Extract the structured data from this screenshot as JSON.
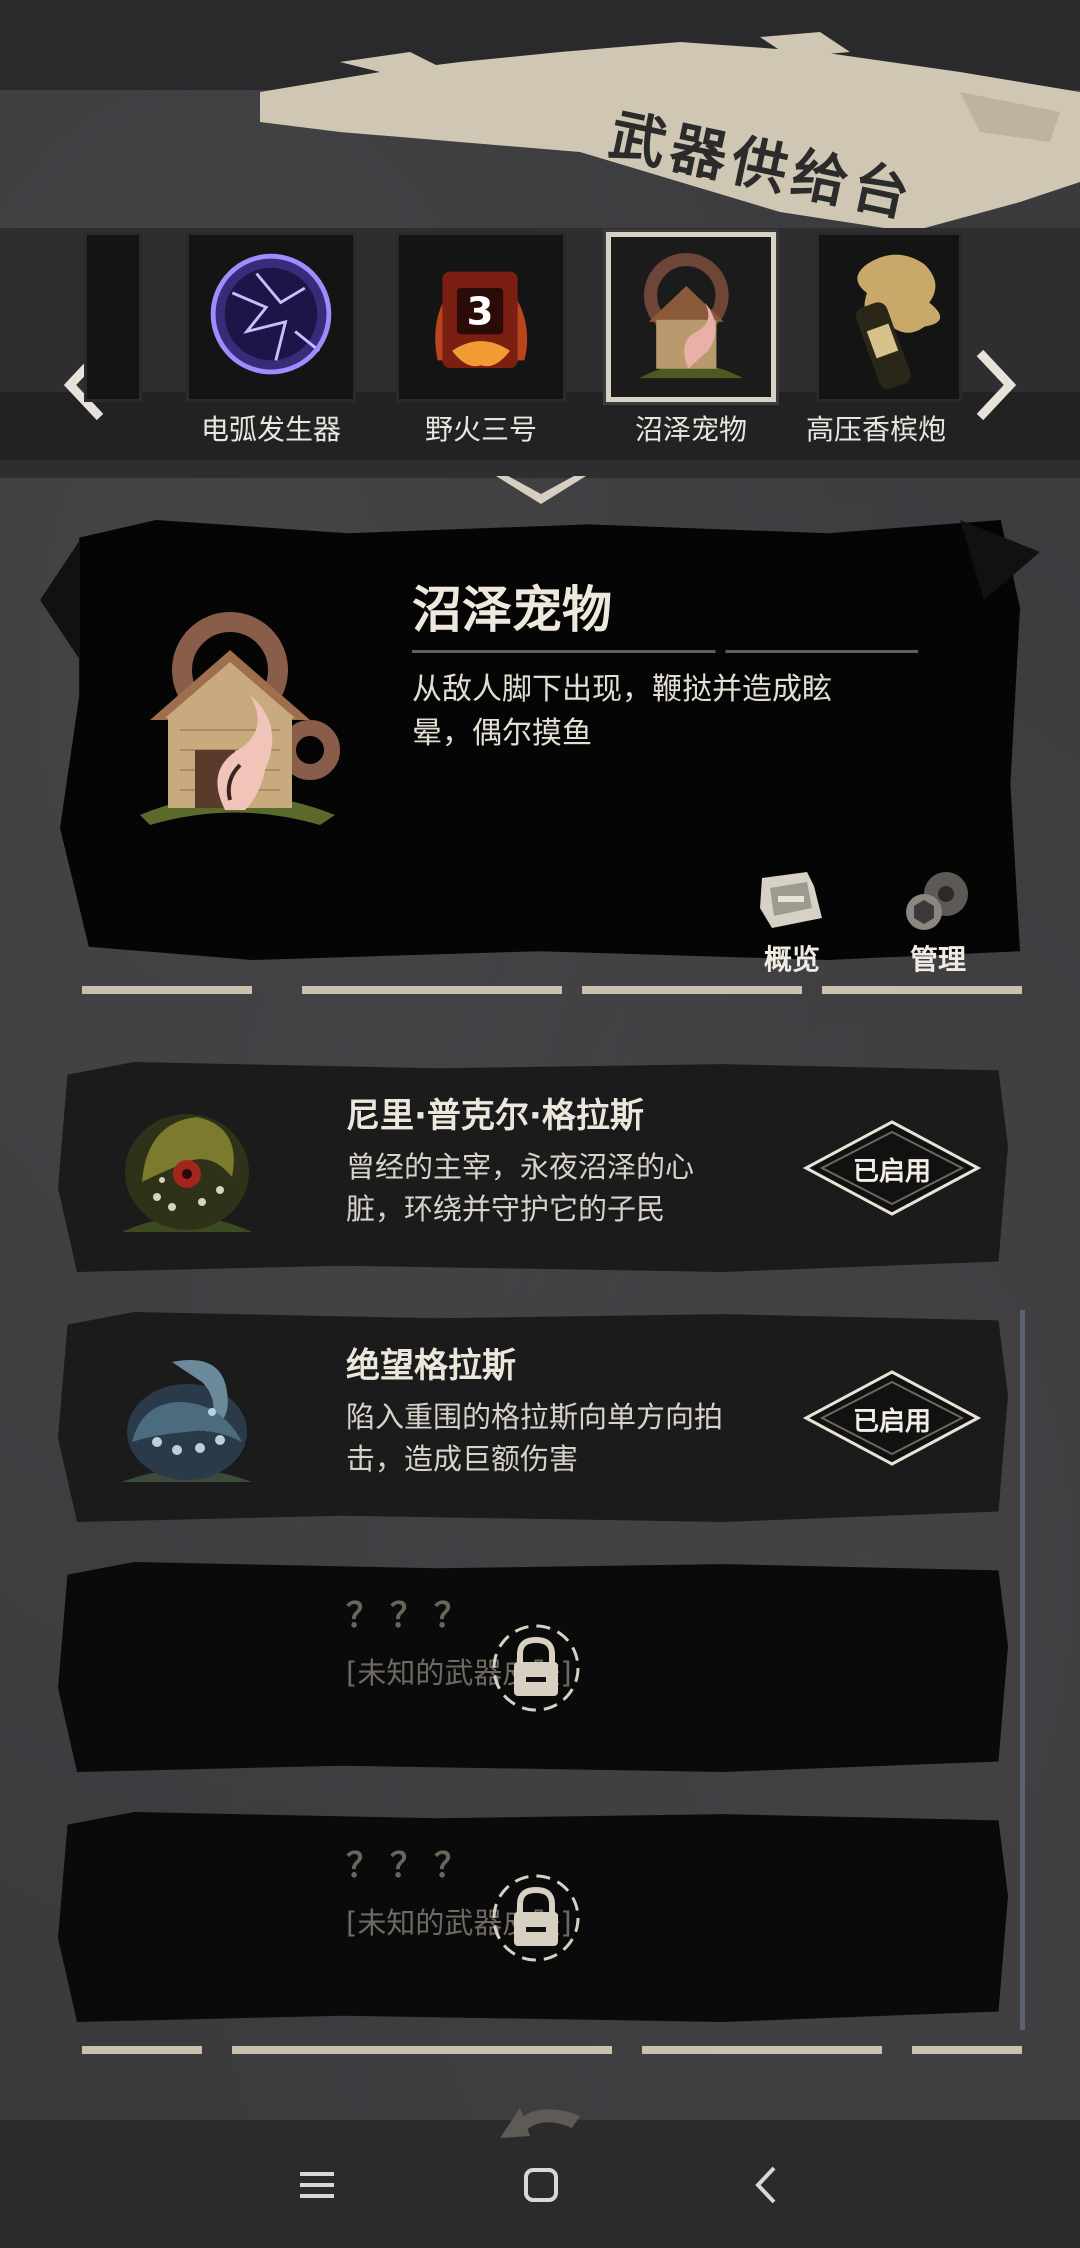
{
  "header": {
    "title": "武器供给台"
  },
  "carousel": {
    "items": [
      {
        "label": "电弧发生器",
        "icon": "arc-generator-icon"
      },
      {
        "label": "野火三号",
        "icon": "wildfire-3-icon",
        "badge": "3"
      },
      {
        "label": "沼泽宠物",
        "icon": "swamp-pet-icon",
        "selected": true
      },
      {
        "label": "高压香槟炮",
        "icon": "champagne-cannon-icon"
      }
    ]
  },
  "detail": {
    "name": "沼泽宠物",
    "description": "从敌人脚下出现，鞭挞并造成眩晕，偶尔摸鱼",
    "overview_label": "概览",
    "manage_label": "管理"
  },
  "list": {
    "items": [
      {
        "title": "尼里·普克尔·格拉斯",
        "description": "曾经的主宰，永夜沼泽的心脏，环绕并守护它的子民",
        "status": "已启用",
        "locked": false,
        "icon": "swamp-creature-green-icon"
      },
      {
        "title": "绝望格拉斯",
        "description": "陷入重围的格拉斯向单方向拍击，造成巨额伤害",
        "status": "已启用",
        "locked": false,
        "icon": "swamp-creature-blue-icon"
      },
      {
        "title": "？？？",
        "description": "[未知的武器皮肤]",
        "locked": true
      },
      {
        "title": "？？？",
        "description": "[未知的武器皮肤]",
        "locked": true
      }
    ]
  },
  "colors": {
    "accent": "#c9c0ad",
    "panel": "#050505",
    "card": "#1b1b1c",
    "background": "#3b3b3e"
  }
}
